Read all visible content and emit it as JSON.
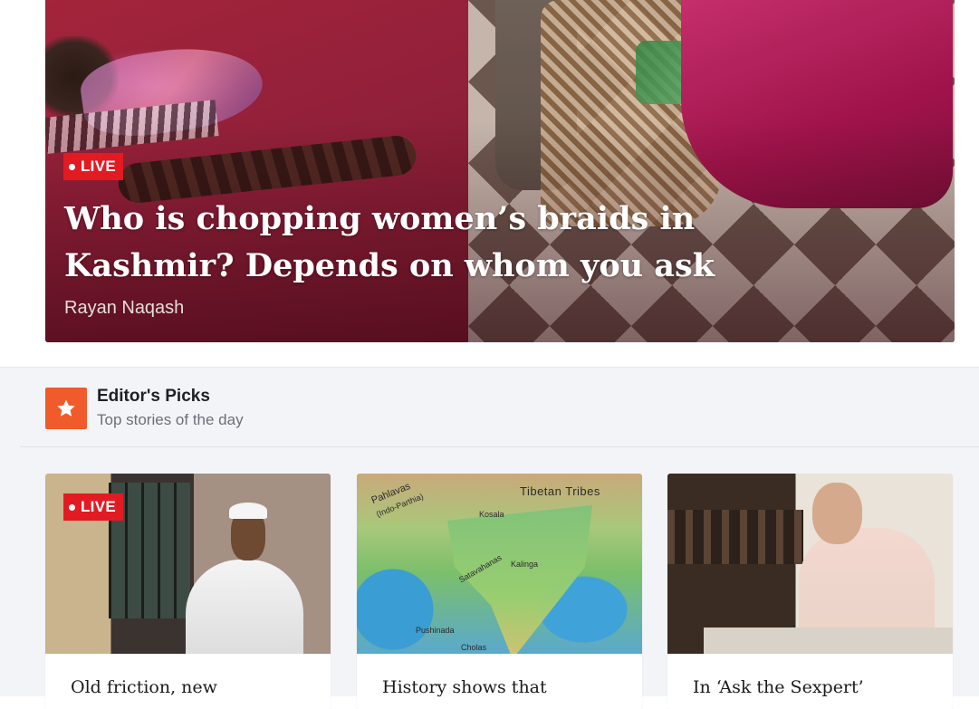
{
  "hero": {
    "badge": "LIVE",
    "title": "Who is chopping women’s braids in Kashmir? Depends on whom you ask",
    "author": "Rayan Naqash"
  },
  "editors_picks": {
    "icon": "star-icon",
    "title": "Editor's Picks",
    "subtitle": "Top stories of the day",
    "cards": [
      {
        "badge": "LIVE",
        "title": "Old friction, new"
      },
      {
        "badge": "",
        "title": "History shows that"
      },
      {
        "badge": "",
        "title": "In ‘Ask the Sexpert’"
      }
    ]
  },
  "map_labels": {
    "tibetan_tribes": "Tibetan  Tribes",
    "pahlavas": "Pahlavas",
    "indo_parthia": "(Indo-Parthia)",
    "satavahanas": "Satavahanas",
    "kalinga": "Kalinga",
    "kosala": "Kosala",
    "pushinada": "Pushinada",
    "cholas": "Cholas"
  },
  "colors": {
    "live_badge": "#e21b23",
    "picks_icon": "#f15a2b",
    "section_bg": "#f3f4f8"
  }
}
